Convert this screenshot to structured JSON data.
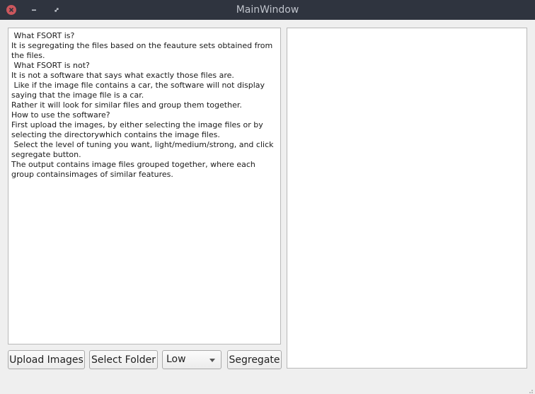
{
  "window": {
    "title": "MainWindow"
  },
  "info_text": {
    "lines": [
      " What FSORT is?",
      "It is segregating the files based on the feauture sets obtained from the files.",
      "",
      " What FSORT is not?",
      "It is not a software that says what exactly those files are.",
      " Like if the image file contains a car, the software will not display saying that the image file is a car.",
      "Rather it will look for similar files and group them together.",
      "",
      "How to use the software?",
      "First upload the images, by either selecting the image files or by selecting the directorywhich contains the image files.",
      " Select the level of tuning you want, light/medium/strong, and click segregate button.",
      "The output contains image files grouped together, where each group containsimages of similar features."
    ]
  },
  "controls": {
    "upload_label": "Upload Images",
    "folder_label": "Select Folder",
    "level_value": "Low",
    "segregate_label": "Segregate"
  },
  "colors": {
    "titlebar": "#2f343f",
    "close": "#cc575d",
    "window_bg": "#efefef"
  }
}
